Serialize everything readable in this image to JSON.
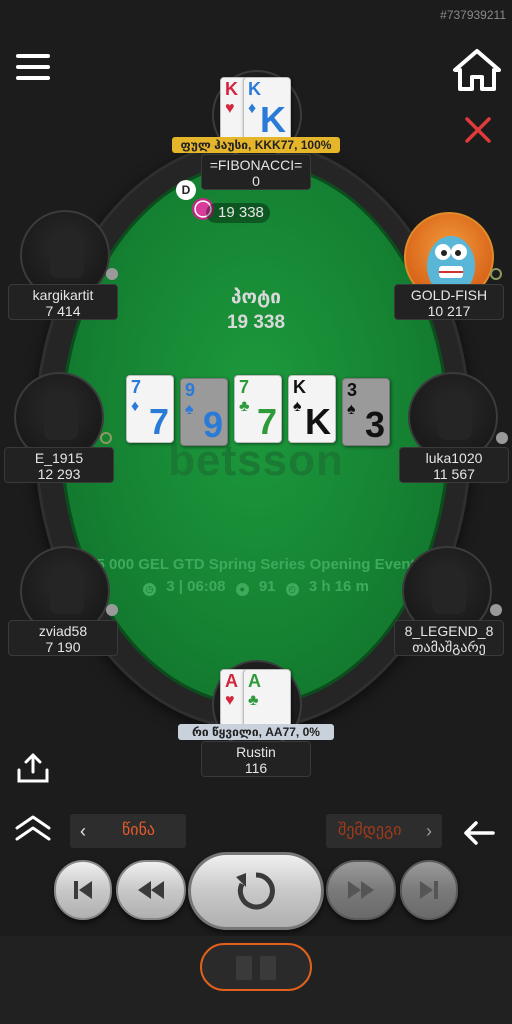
{
  "hand_id": "#737939211",
  "pot": {
    "label": "პოტი",
    "amount": "19 338"
  },
  "bet": {
    "amount": "19 338"
  },
  "dealer_label": "D",
  "brand": "betsson",
  "tournament": {
    "name": "5 000 GEL GTD Spring Series Opening Event",
    "level": "3 | 06:08",
    "players": "91",
    "duration": "3 h 16 m"
  },
  "board": [
    {
      "rank": "7",
      "suit": "♦",
      "color": "blue",
      "dim": false
    },
    {
      "rank": "9",
      "suit": "♠",
      "color": "blue",
      "dim": true
    },
    {
      "rank": "7",
      "suit": "♣",
      "color": "green",
      "dim": false
    },
    {
      "rank": "K",
      "suit": "♠",
      "color": "black",
      "dim": false
    },
    {
      "rank": "3",
      "suit": "♠",
      "color": "black",
      "dim": true
    }
  ],
  "players": {
    "top": {
      "name": "=FIBONACCI=",
      "stack": "0",
      "hand": "ფულ ჰაუსი, KKK77, 100%",
      "cards": [
        {
          "rank": "K",
          "suit": "♥",
          "color": "red"
        },
        {
          "rank": "K",
          "suit": "♦",
          "color": "blue"
        }
      ]
    },
    "left_upper": {
      "name": "kargikartit",
      "stack": "7 414"
    },
    "left_mid": {
      "name": "E_1915",
      "stack": "12 293"
    },
    "left_lower": {
      "name": "zviad58",
      "stack": "7 190"
    },
    "right_upper": {
      "name": "GOLD-FISH",
      "stack": "10 217"
    },
    "right_mid": {
      "name": "luka1020",
      "stack": "11 567"
    },
    "right_lower": {
      "name": "8_LEGEND_8",
      "stack": "თამაშგარე"
    },
    "bottom": {
      "name": "Rustin",
      "stack": "116",
      "hand": "რი წყვილი, AA77, 0%",
      "cards": [
        {
          "rank": "A",
          "suit": "♥",
          "color": "red"
        },
        {
          "rank": "A",
          "suit": "♣",
          "color": "green"
        }
      ]
    }
  },
  "nav": {
    "prev_label": "წინა",
    "next_label": "შემდეგი"
  },
  "icons": [
    "menu-icon",
    "home-icon",
    "close-icon",
    "share-icon",
    "chevrons-up-icon",
    "back-arrow-icon",
    "skip-first-icon",
    "rewind-icon",
    "replay-icon",
    "fast-forward-icon",
    "skip-last-icon",
    "pause-icon"
  ],
  "colors": {
    "felt": "#158232",
    "accent": "#e0601c",
    "winner_badge": "#e5b52a",
    "loser_badge": "#c9d2dc"
  }
}
